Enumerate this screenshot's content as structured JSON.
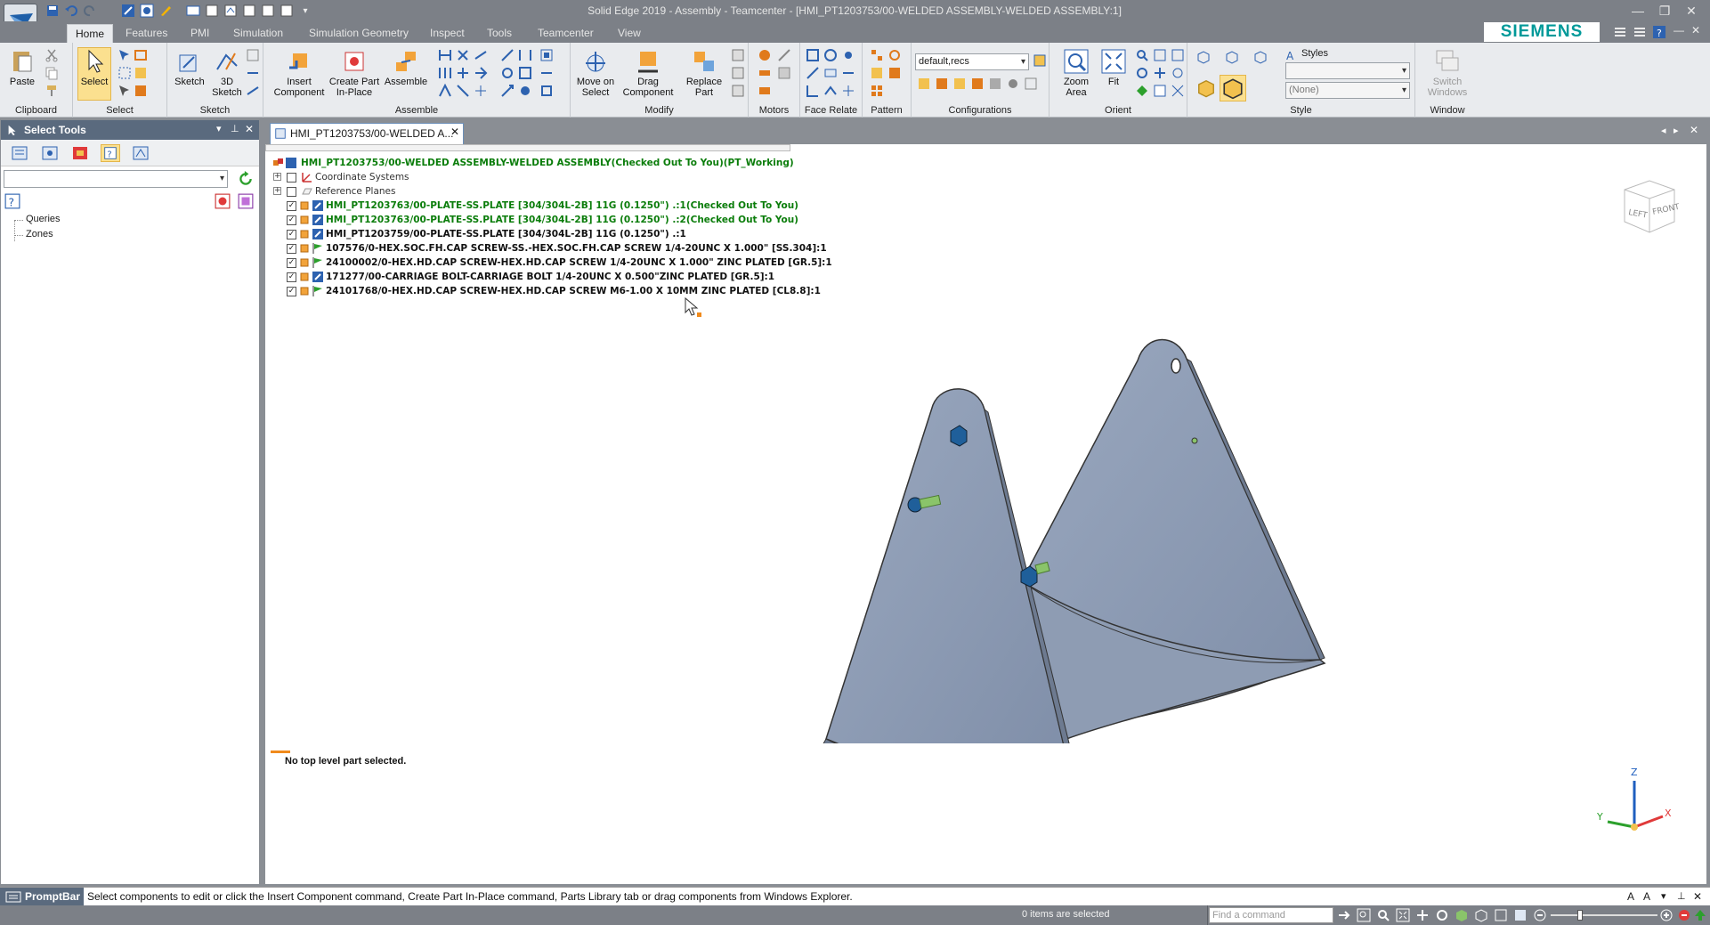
{
  "window": {
    "title": "Solid Edge 2019 - Assembly - Teamcenter - [HMI_PT1203753/00-WELDED ASSEMBLY-WELDED ASSEMBLY:1]",
    "controls": [
      "—",
      "❐",
      "✕"
    ]
  },
  "ribbon_tabs": [
    {
      "label": "Home",
      "active": true
    },
    {
      "label": "Features"
    },
    {
      "label": "PMI"
    },
    {
      "label": "Simulation"
    },
    {
      "label": "Simulation Geometry"
    },
    {
      "label": "Inspect"
    },
    {
      "label": "Tools"
    },
    {
      "label": "Teamcenter"
    },
    {
      "label": "View"
    }
  ],
  "brand": "SIEMENS",
  "ribbon": {
    "groups": {
      "clipboard": "Clipboard",
      "select": "Select",
      "sketch": "Sketch",
      "assemble": "Assemble",
      "modify": "Modify",
      "motors": "Motors",
      "face_relate": "Face Relate",
      "pattern": "Pattern",
      "configurations": "Configurations",
      "orient": "Orient",
      "style": "Style",
      "window": "Window"
    },
    "buttons": {
      "paste": "Paste",
      "select": "Select",
      "sketch": "Sketch",
      "sketch3d_1": "3D",
      "sketch3d_2": "Sketch",
      "insert_1": "Insert",
      "insert_2": "Component",
      "create_1": "Create Part",
      "create_2": "In-Place",
      "assemble": "Assemble",
      "move_1": "Move on",
      "move_2": "Select",
      "drag_1": "Drag",
      "drag_2": "Component",
      "replace_1": "Replace",
      "replace_2": "Part",
      "zoom_1": "Zoom",
      "zoom_2": "Area",
      "fit": "Fit",
      "switch_1": "Switch",
      "switch_2": "Windows"
    },
    "config_value": "default,recs",
    "styles_label": "Styles",
    "style_value": "(None)"
  },
  "left_panel": {
    "title": "Select Tools",
    "tree": [
      "Queries",
      "Zones"
    ]
  },
  "document": {
    "tab_label": "HMI_PT1203753/00-WELDED A...",
    "tree": {
      "root": "HMI_PT1203753/00-WELDED ASSEMBLY-WELDED ASSEMBLY(Checked Out To You)(PT_Working)",
      "folders": [
        "Coordinate Systems",
        "Reference Planes"
      ],
      "items": [
        {
          "label": "HMI_PT1203763/00-PLATE-SS.PLATE [304/304L-2B] 11G (0.1250\") .:1(Checked Out To You)",
          "style": "green"
        },
        {
          "label": "HMI_PT1203763/00-PLATE-SS.PLATE [304/304L-2B] 11G (0.1250\") .:2(Checked Out To You)",
          "style": "green"
        },
        {
          "label": "HMI_PT1203759/00-PLATE-SS.PLATE [304/304L-2B] 11G (0.1250\") .:1",
          "style": "black"
        },
        {
          "label": "107576/0-HEX.SOC.FH.CAP SCREW-SS.-HEX.SOC.FH.CAP SCREW 1/4-20UNC X 1.000\" [SS.304]:1",
          "style": "black"
        },
        {
          "label": "24100002/0-HEX.HD.CAP SCREW-HEX.HD.CAP SCREW 1/4-20UNC X 1.000\" ZINC PLATED [GR.5]:1",
          "style": "black"
        },
        {
          "label": "171277/00-CARRIAGE BOLT-CARRIAGE BOLT 1/4-20UNC X 0.500\"ZINC PLATED [GR.5]:1",
          "style": "black"
        },
        {
          "label": "24101768/0-HEX.HD.CAP SCREW-HEX.HD.CAP SCREW M6-1.00 X 10MM ZINC PLATED [CL8.8]:1",
          "style": "black"
        }
      ]
    },
    "status_message": "No top level part selected.",
    "viewcube": {
      "left": "LEFT",
      "front": "FRONT"
    },
    "axes": {
      "x": "X",
      "y": "Y",
      "z": "Z"
    }
  },
  "promptbar": {
    "label": "PromptBar",
    "text": "Select components to edit or click the Insert Component command, Create Part In-Place command, Parts Library tab or drag components from Windows Explorer."
  },
  "statusbar": {
    "selection": "0 items are selected",
    "find_placeholder": "Find a command"
  },
  "colors": {
    "titlebar": "#7c8087",
    "ribbon": "#e9ebee",
    "panel_header": "#5a6a7e",
    "part_steel": "#8c9cb4",
    "tree_green": "#0b7d0b",
    "siemens": "#009999"
  }
}
